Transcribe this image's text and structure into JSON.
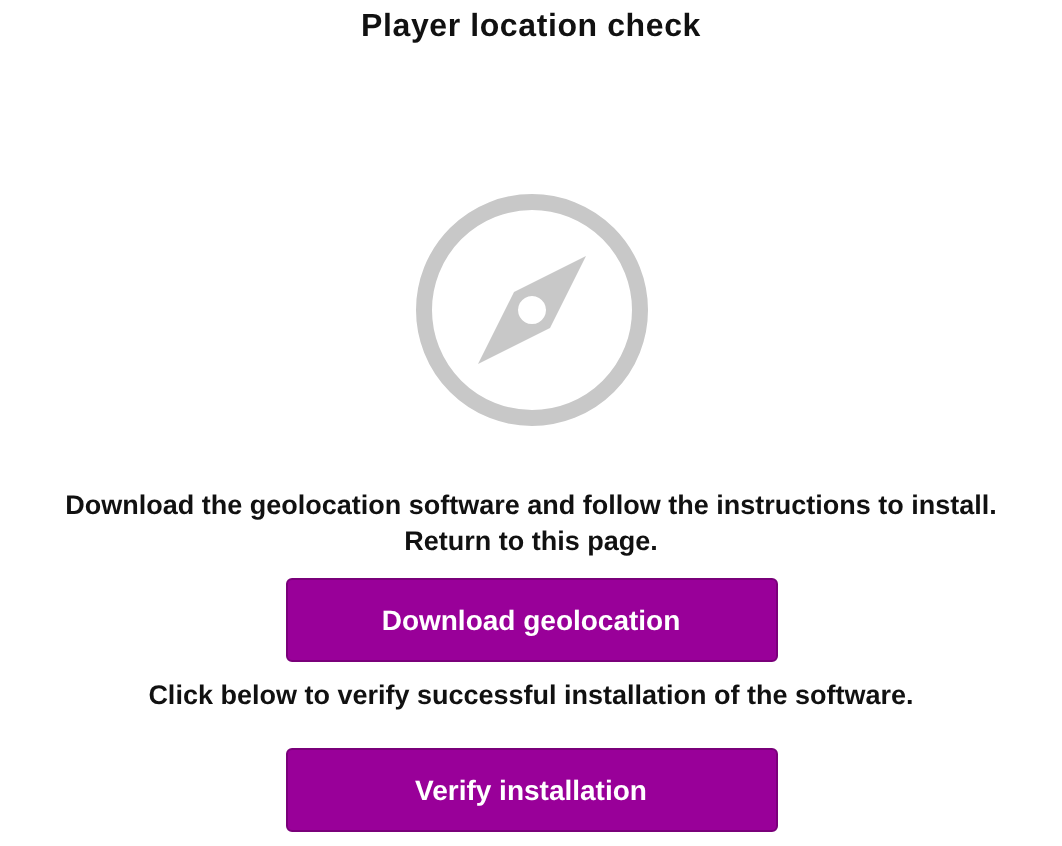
{
  "title": "Player location check",
  "instructions": "Download the geolocation software and follow the instructions to install. Return to this page.",
  "download_button": "Download geolocation",
  "verify_text": "Click below to verify successful installation of the software.",
  "verify_button": "Verify installation"
}
